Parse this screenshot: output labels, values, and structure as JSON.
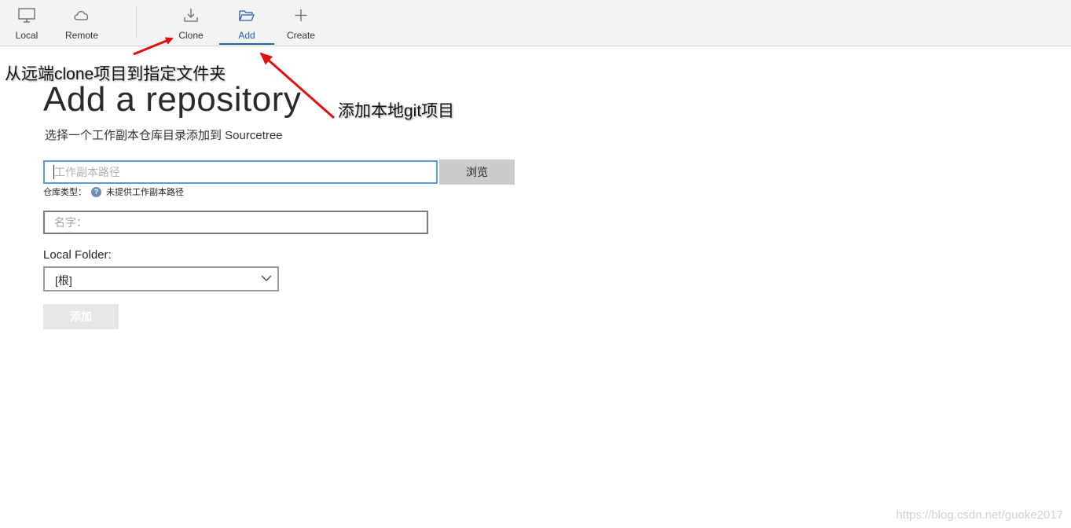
{
  "toolbar": {
    "local_label": "Local",
    "remote_label": "Remote",
    "clone_label": "Clone",
    "add_label": "Add",
    "create_label": "Create",
    "active_tab": "Add",
    "accent_color": "#1f5fb0"
  },
  "main": {
    "title": "Add a repository",
    "subtitle": "选择一个工作副本仓库目录添加到 Sourcetree",
    "path_placeholder": "工作副本路径",
    "browse_label": "浏览",
    "repo_type_label": "仓库类型：",
    "repo_type_value": "未提供工作副本路径",
    "name_placeholder": "名字：",
    "local_folder_label": "Local Folder:",
    "local_folder_value": "[根]",
    "add_button_label": "添加"
  },
  "annotations": {
    "clone_note": "从远端clone项目到指定文件夹",
    "add_note": "添加本地git项目",
    "arrow_color": "#e01010"
  },
  "watermark": "https://blog.csdn.net/guoke2017",
  "icons": [
    "monitor-icon",
    "cloud-icon",
    "download-icon",
    "folder-open-icon",
    "plus-icon",
    "help-icon",
    "chevron-down-icon"
  ]
}
